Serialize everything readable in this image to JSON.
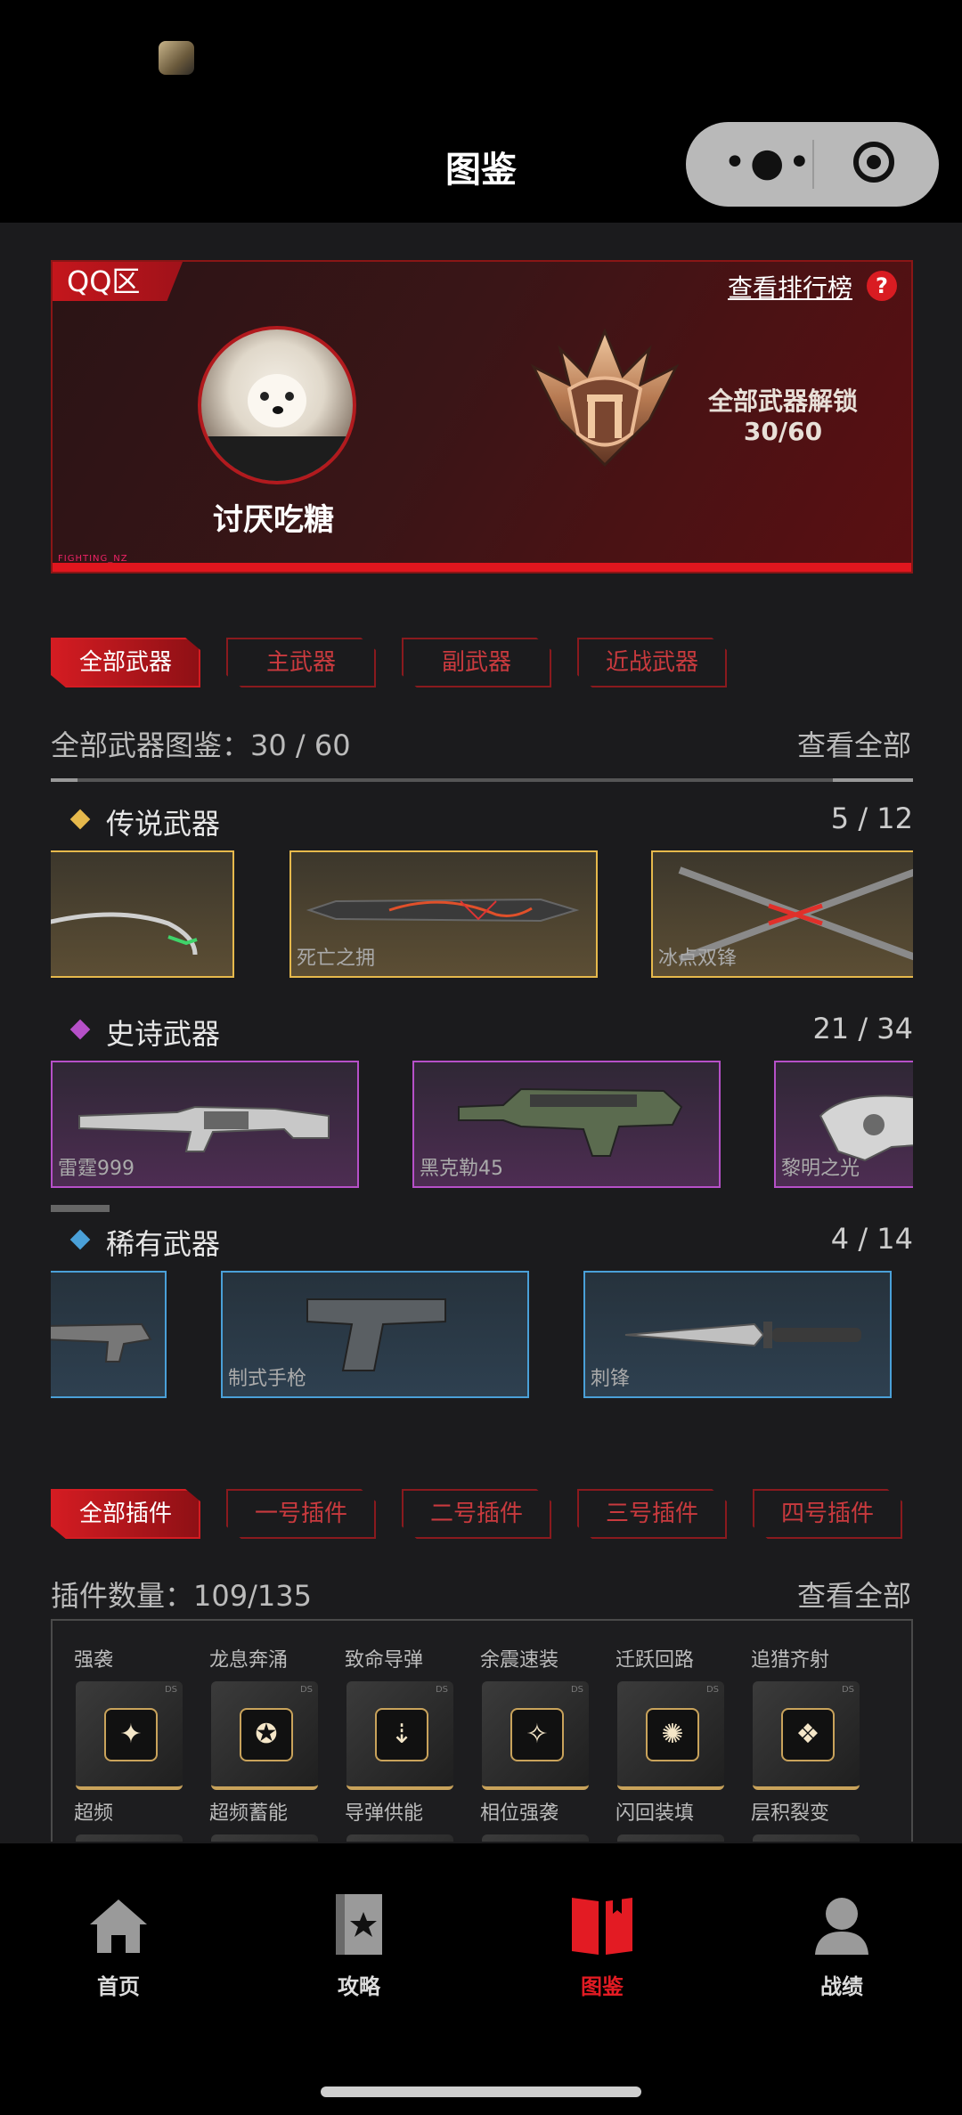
{
  "header": {
    "title": "图鉴"
  },
  "profile": {
    "region": "QQ区",
    "rank_link": "查看排行榜",
    "help": "?",
    "username": "讨厌吃糖",
    "unlock_label": "全部武器解锁",
    "unlock_value": "30/60",
    "footer_text": "FIGHTING_NZ"
  },
  "weapon_tabs": [
    "全部武器",
    "主武器",
    "副武器",
    "近战武器"
  ],
  "weapon_summary": {
    "label": "全部武器图鉴：30 / 60",
    "view_all": "查看全部"
  },
  "categories": [
    {
      "name": "传说武器",
      "count": "5 / 12",
      "color": "#e6b94c",
      "items": [
        "",
        "死亡之拥",
        "冰点双锋"
      ]
    },
    {
      "name": "史诗武器",
      "count": "21 / 34",
      "color": "#b650c8",
      "items": [
        "雷霆999",
        "黑克勒45",
        "黎明之光"
      ]
    },
    {
      "name": "稀有武器",
      "count": "4 / 14",
      "color": "#4aa0d8",
      "items": [
        "",
        "制式手枪",
        "刺锋"
      ]
    }
  ],
  "plugin_tabs": [
    "全部插件",
    "一号插件",
    "二号插件",
    "三号插件",
    "四号插件"
  ],
  "plugin_summary": {
    "label": "插件数量：109/135",
    "view_all": "查看全部"
  },
  "plugins_row1": [
    "强袭",
    "龙息奔涌",
    "致命导弹",
    "余震速装",
    "迁跃回路",
    "追猎齐射"
  ],
  "plugins_row2": [
    "超频",
    "超频蓄能",
    "导弹供能",
    "相位强袭",
    "闪回装填",
    "层积裂变"
  ],
  "nav": [
    {
      "label": "首页",
      "icon": "home-icon"
    },
    {
      "label": "攻略",
      "icon": "guide-card-icon"
    },
    {
      "label": "图鉴",
      "icon": "book-icon",
      "active": true
    },
    {
      "label": "战绩",
      "icon": "user-icon"
    }
  ],
  "accent": "#e31b23"
}
